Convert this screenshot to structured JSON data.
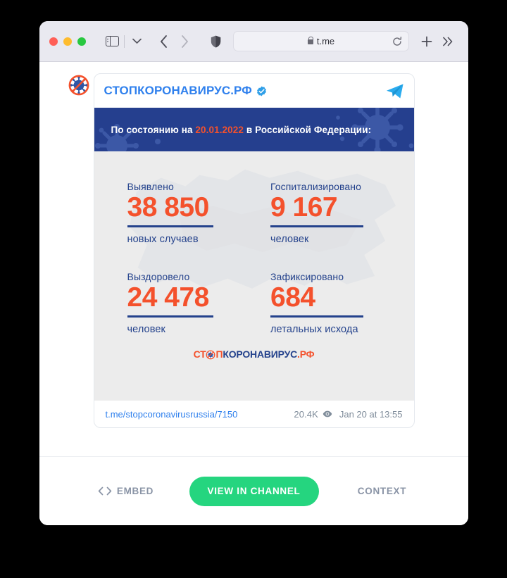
{
  "browser": {
    "traffic_lights": [
      "close",
      "minimize",
      "zoom"
    ],
    "url": "t.me",
    "icons": {
      "sidebar": "sidebar-icon",
      "chevron_down": "chevron-down-icon",
      "back": "back-arrow-icon",
      "forward": "forward-arrow-icon",
      "shield": "shield-icon",
      "lock": "lock-icon",
      "reload": "reload-icon",
      "new_tab": "plus-icon",
      "more": "chevrons-right-icon"
    }
  },
  "post": {
    "channel_name": "СТОПКОРОНАВИРУС.РФ",
    "verified": true,
    "avatar_icon": "stop-coronavirus-avatar-icon",
    "telegram_icon": "telegram-logo-icon",
    "link": "t.me/stopcoronavirusrussia/7150",
    "views": "20.4K",
    "views_icon": "eye-icon",
    "date": "Jan 20 at 13:55"
  },
  "infographic": {
    "banner_prefix": "По состоянию на ",
    "banner_date": "20.01.2022",
    "banner_suffix": " в Российской Федерации:",
    "stats": [
      {
        "label": "Выявлено",
        "value": "38 850",
        "unit": "новых случаев"
      },
      {
        "label": "Госпитализировано",
        "value": "9 167",
        "unit": "человек"
      },
      {
        "label": "Выздоровело",
        "value": "24 478",
        "unit": "человек"
      },
      {
        "label": "Зафиксировано",
        "value": "684",
        "unit": "летальных исхода"
      }
    ],
    "logo": {
      "part1": "СТ",
      "part2": "П",
      "part3": "КОРОНАВИРУС",
      "part4": ".РФ",
      "icon": "stop-coronavirus-logo-icon"
    },
    "colors": {
      "banner_bg": "#253f8e",
      "accent_orange": "#f4512c",
      "label_blue": "#24428c",
      "background": "#ececec"
    }
  },
  "actions": {
    "embed_label": "EMBED",
    "embed_icon": "code-brackets-icon",
    "view_label": "VIEW IN CHANNEL",
    "context_label": "CONTEXT",
    "button_color": "#25d57f"
  }
}
